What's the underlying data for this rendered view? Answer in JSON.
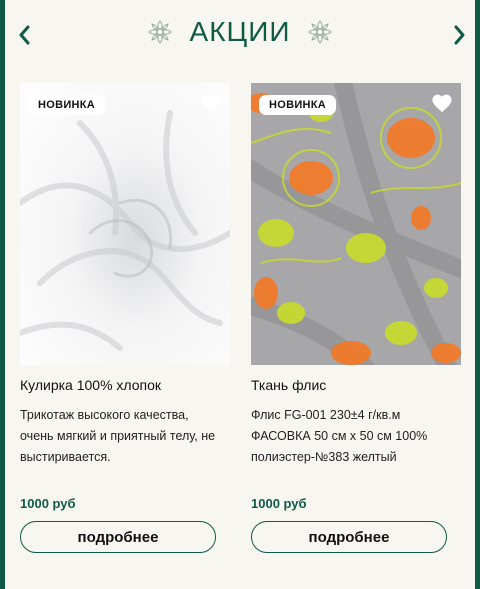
{
  "header": {
    "title": "АКЦИИ",
    "prev_icon": "chevron-left-icon",
    "next_icon": "chevron-right-icon",
    "ornament_icon": "flower-ornament-icon"
  },
  "colors": {
    "accent": "#0e5a45",
    "background": "#f8f6f1"
  },
  "products": [
    {
      "badge": "НОВИНКА",
      "name": "Кулирка 100% хлопок",
      "description": "Трикотаж высокого качества, очень мягкий и приятный телу, не выстиривается.",
      "price": "1000 руб",
      "button": "подробнее",
      "favorite_icon": "heart-icon"
    },
    {
      "badge": "НОВИНКА",
      "name": "Ткань флис",
      "description": "Флис FG-001 230±4 г/кв.м ФАСОВКА 50 см х 50 см 100% полиэстер-№383 желтый",
      "price": "1000 руб",
      "button": "подробнее",
      "favorite_icon": "heart-icon"
    }
  ]
}
